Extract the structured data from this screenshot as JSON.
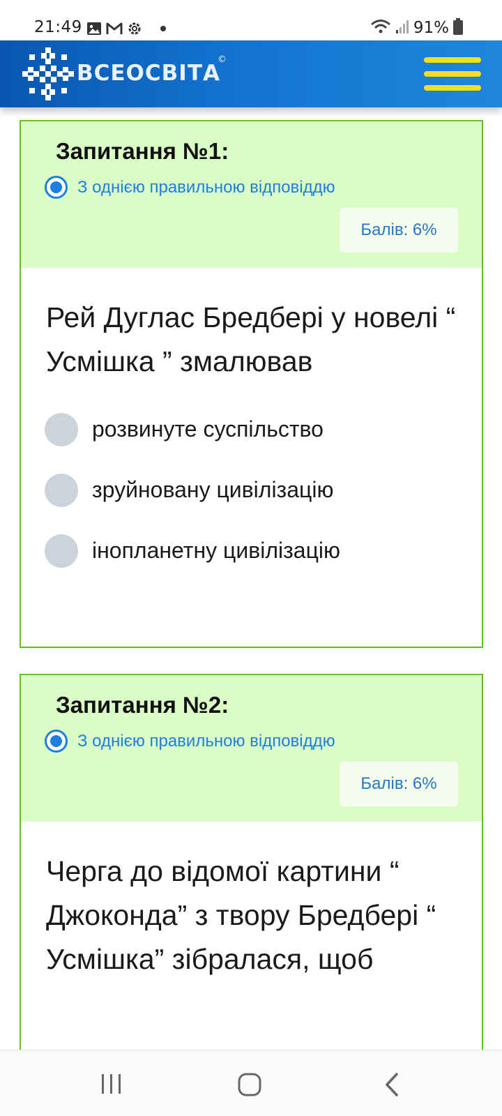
{
  "status_bar": {
    "time": "21:49",
    "battery": "91%",
    "icons": [
      "gallery-icon",
      "gmail-icon",
      "settings-icon",
      "dot-icon",
      "wifi-icon",
      "signal-icon",
      "battery-icon"
    ]
  },
  "header": {
    "logo_text": "ВСЕОСВІТА",
    "logo_mark": "©",
    "accent_color": "#f7de1c"
  },
  "questions": [
    {
      "title": "Запитання №1:",
      "type_label": "З однією правильною відповіддю",
      "points": "Балів: 6%",
      "text": "Рей Дуглас Бредбері у новелі “ Усмішка ” змалював",
      "options": [
        "розвинуте суспільство",
        "зруйновану цивілізацію",
        "інопланетну цивілізацію"
      ]
    },
    {
      "title": "Запитання №2:",
      "type_label": "З однією правильною відповіддю",
      "points": "Балів: 6%",
      "text": "Черга до відомої картини “ Джоконда” з твору Бредбері “ Усмішка” зібралася, щоб"
    }
  ],
  "colors": {
    "card_border": "#63c02b",
    "card_header_bg": "#d9fdc5",
    "accent_blue": "#1f7fe0"
  }
}
